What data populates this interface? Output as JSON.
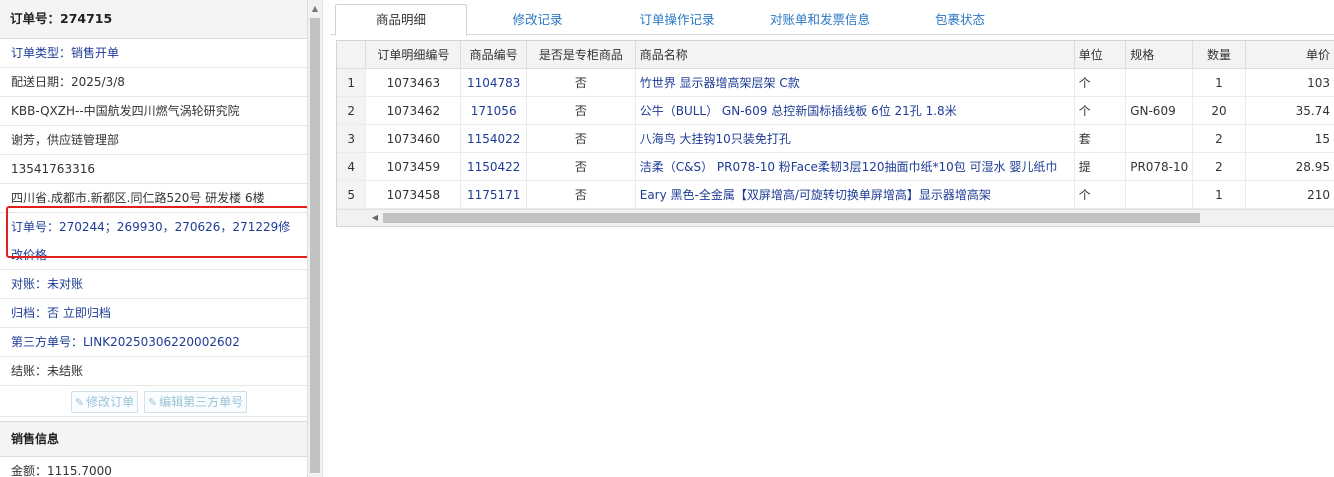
{
  "left": {
    "order_header": "订单号：274715",
    "rows": {
      "order_type": "订单类型：销售开单",
      "delivery_date": "配送日期：2025/3/8",
      "customer": "KBB-QXZH--中国航发四川燃气涡轮研究院",
      "contact": "谢芳，供应链管理部",
      "phone": "13541763316",
      "address": "四川省.成都市.新都区.同仁路520号 研发楼 6楼",
      "order_no_line1": "订单号：270244；269930，270626，271229修",
      "order_no_line2": "改价格",
      "reconcile": "对账：未对账",
      "archive_label": "归档：",
      "archive_value": "否 立即归档",
      "third_party": "第三方单号：LINK20250306220002602",
      "settlement": "结账：未结账"
    },
    "buttons": {
      "edit_order": "修改订单",
      "edit_third_party": "编辑第三方单号"
    },
    "sales_section": "销售信息",
    "amount": "金额：1115.7000"
  },
  "tabs": [
    "商品明细",
    "修改记录",
    "订单操作记录",
    "对账单和发票信息",
    "包裹状态"
  ],
  "active_tab": 0,
  "grid": {
    "columns": [
      "",
      "订单明细编号",
      "商品编号",
      "是否是专柜商品",
      "商品名称",
      "单位",
      "规格",
      "数量",
      "单价"
    ],
    "rows": [
      [
        "1",
        "1073463",
        "1104783",
        "否",
        "竹世界 显示器增高架层架 C款",
        "个",
        "",
        "1",
        "103"
      ],
      [
        "2",
        "1073462",
        "171056",
        "否",
        "公牛（BULL） GN-609 总控新国标插线板 6位 21孔 1.8米",
        "个",
        "GN-609",
        "20",
        "35.74"
      ],
      [
        "3",
        "1073460",
        "1154022",
        "否",
        "八海鸟 大挂钩10只装免打孔",
        "套",
        "",
        "2",
        "15"
      ],
      [
        "4",
        "1073459",
        "1150422",
        "否",
        "洁柔（C&S） PR078-10 粉Face柔韧3层120抽面巾纸*10包 可湿水 婴儿纸巾",
        "提",
        "PR078-10",
        "2",
        "28.95"
      ],
      [
        "5",
        "1073458",
        "1175171",
        "否",
        "Eary 黑色-全金属【双屏增高/可旋转切换单屏增高】显示器增高架",
        "个",
        "",
        "1",
        "210"
      ]
    ]
  },
  "colors": {
    "link": "#1e3c96",
    "tab_link": "#2a78c4",
    "highlight_border": "#e0201f",
    "header_bg": "#f4f4f4"
  },
  "icons": [
    "edit-icon",
    "arrow-up-icon",
    "arrow-left-icon"
  ]
}
